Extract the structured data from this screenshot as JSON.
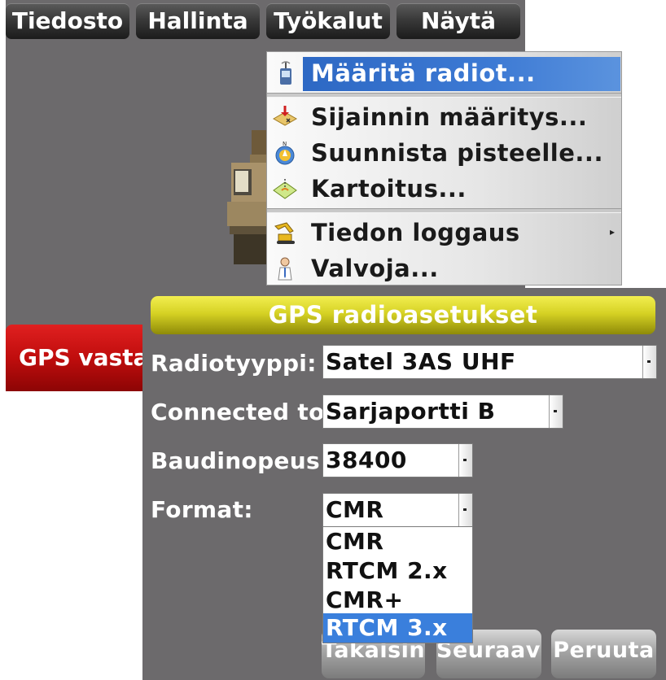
{
  "menubar": {
    "items": [
      "Tiedosto",
      "Hallinta",
      "Työkalut",
      "Näytä"
    ]
  },
  "tools_menu": {
    "items": [
      {
        "label": "Määritä radiot...",
        "icon": "radio-device-icon",
        "selected": true
      },
      {
        "label": "Sijainnin määritys...",
        "icon": "location-setup-icon"
      },
      {
        "label": "Suunnista pisteelle...",
        "icon": "compass-navigate-icon"
      },
      {
        "label": "Kartoitus...",
        "icon": "survey-map-icon"
      },
      {
        "label": "Tiedon loggaus",
        "icon": "excavator-log-icon",
        "has_submenu": true
      },
      {
        "label": "Valvoja...",
        "icon": "supervisor-person-icon"
      }
    ]
  },
  "gps_button": {
    "label": "GPS vastaanotin"
  },
  "dialog": {
    "title": "GPS radioasetukset",
    "radio_type": {
      "label": "Radiotyyppi:",
      "value": "Satel 3AS UHF"
    },
    "connected_to": {
      "label": "Connected to:",
      "value": "Sarjaportti B"
    },
    "baud_rate": {
      "label": "Baudinopeus:",
      "value": "38400"
    },
    "format": {
      "label": "Format:",
      "value": "CMR",
      "options": [
        "CMR",
        "RTCM 2.x",
        "CMR+",
        "RTCM 3.x"
      ],
      "highlighted": "RTCM 3.x"
    },
    "buttons": {
      "back": "Takaisin",
      "next": "Seuraava",
      "cancel": "Peruuta"
    }
  },
  "colors": {
    "menu_highlight": "#3d7ad4",
    "title_bar": "#d6d224",
    "gps_button": "#c00d0d",
    "dialog_bg": "#6c6a6c"
  }
}
